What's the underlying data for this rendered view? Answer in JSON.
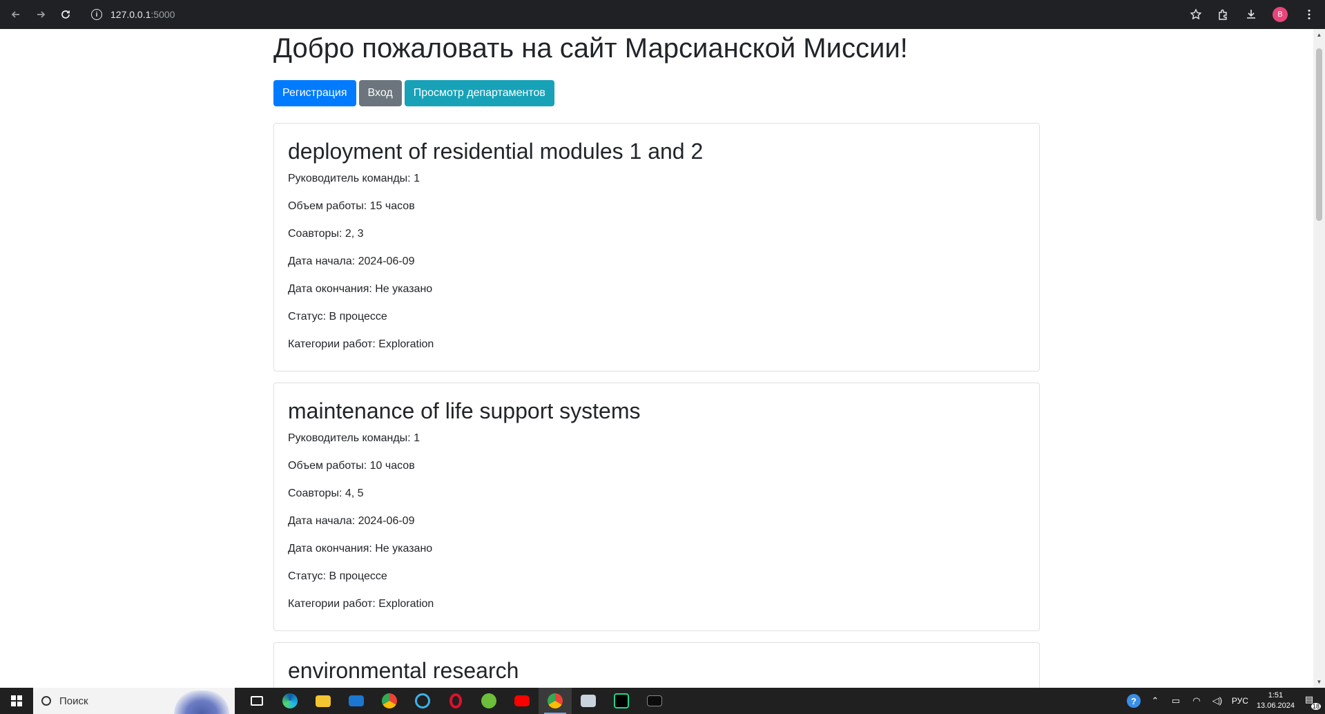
{
  "browser": {
    "url_host": "127.0.0.1",
    "url_port": ":5000",
    "profile_initial": "B"
  },
  "page": {
    "title": "Добро пожаловать на сайт Марсианской Миссии!",
    "buttons": {
      "register": "Регистрация",
      "login": "Вход",
      "departments": "Просмотр департаментов"
    },
    "jobs": [
      {
        "title": "deployment of residential modules 1 and 2",
        "leader": "Руководитель команды: 1",
        "work_size": "Объем работы: 15 часов",
        "collaborators": "Соавторы: 2, 3",
        "start_date": "Дата начала: 2024-06-09",
        "end_date": "Дата окончания: Не указано",
        "status": "Статус: В процессе",
        "categories": "Категории работ: Exploration"
      },
      {
        "title": "maintenance of life support systems",
        "leader": "Руководитель команды: 1",
        "work_size": "Объем работы: 10 часов",
        "collaborators": "Соавторы: 4, 5",
        "start_date": "Дата начала: 2024-06-09",
        "end_date": "Дата окончания: Не указано",
        "status": "Статус: В процессе",
        "categories": "Категории работ: Exploration"
      },
      {
        "title": "environmental research"
      }
    ]
  },
  "taskbar": {
    "search_label": "Поиск",
    "language": "РУС",
    "time": "1:51",
    "date": "13.06.2024",
    "notification_count": "18"
  },
  "colors": {
    "primary": "#007bff",
    "secondary": "#6c757d",
    "info": "#17a2b8"
  }
}
